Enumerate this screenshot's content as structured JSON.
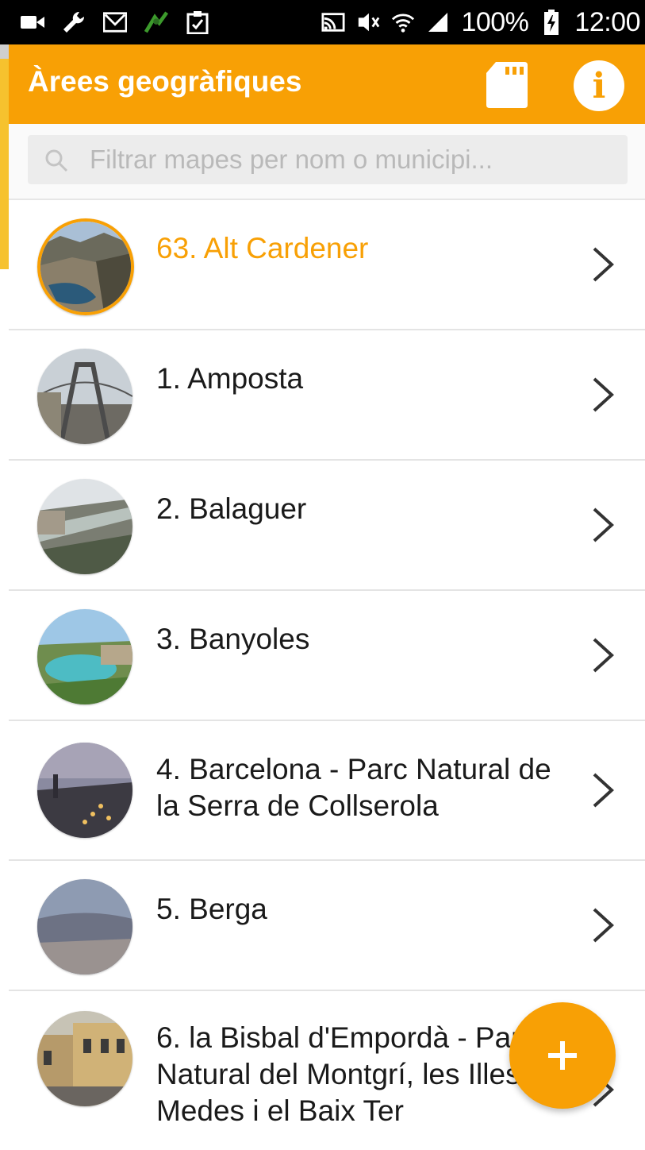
{
  "status_bar": {
    "battery": "100%",
    "time": "12:00",
    "icons": [
      "video-icon",
      "wrench-icon",
      "gmail-icon",
      "location-app-icon",
      "clipboard-icon",
      "cast-icon",
      "vibrate-icon",
      "wifi-icon",
      "signal-icon",
      "battery-charging-icon"
    ]
  },
  "app_bar": {
    "title": "Àrees geogràfiques",
    "sd_icon": "sd-card-icon",
    "info_icon": "info-icon",
    "info_glyph": "i"
  },
  "search": {
    "placeholder": "Filtrar mapes per nom o municipi...",
    "icon": "search-icon"
  },
  "colors": {
    "accent": "#f8a005",
    "text": "#1a1a1a"
  },
  "areas": [
    {
      "label": "63. Alt Cardener",
      "selected": true
    },
    {
      "label": "1. Amposta",
      "selected": false
    },
    {
      "label": "2. Balaguer",
      "selected": false
    },
    {
      "label": "3. Banyoles",
      "selected": false
    },
    {
      "label": "4. Barcelona - Parc Natural de la Serra de Collserola",
      "selected": false
    },
    {
      "label": "5. Berga",
      "selected": false
    },
    {
      "label": "6. la Bisbal d'Empordà - Parc Natural del Montgrí, les Illes Medes i el Baix Ter",
      "selected": false
    }
  ],
  "fab": {
    "glyph": "+",
    "icon": "add-icon"
  }
}
